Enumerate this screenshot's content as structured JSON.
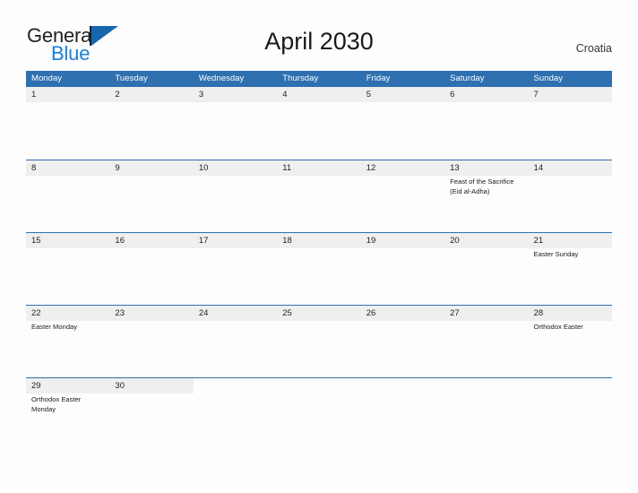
{
  "brand": {
    "name_part1": "General",
    "name_part2": "Blue",
    "logo_icon": "triangle-logo-icon"
  },
  "header": {
    "title": "April 2030",
    "country": "Croatia"
  },
  "calendar": {
    "weekdays": [
      "Monday",
      "Tuesday",
      "Wednesday",
      "Thursday",
      "Friday",
      "Saturday",
      "Sunday"
    ],
    "accent_color": "#2e70b0",
    "band_color": "#efefef",
    "weeks": [
      [
        {
          "day": "1",
          "events": []
        },
        {
          "day": "2",
          "events": []
        },
        {
          "day": "3",
          "events": []
        },
        {
          "day": "4",
          "events": []
        },
        {
          "day": "5",
          "events": []
        },
        {
          "day": "6",
          "events": []
        },
        {
          "day": "7",
          "events": []
        }
      ],
      [
        {
          "day": "8",
          "events": []
        },
        {
          "day": "9",
          "events": []
        },
        {
          "day": "10",
          "events": []
        },
        {
          "day": "11",
          "events": []
        },
        {
          "day": "12",
          "events": []
        },
        {
          "day": "13",
          "events": [
            "Feast of the Sacrifice (Eid al-Adha)"
          ]
        },
        {
          "day": "14",
          "events": []
        }
      ],
      [
        {
          "day": "15",
          "events": []
        },
        {
          "day": "16",
          "events": []
        },
        {
          "day": "17",
          "events": []
        },
        {
          "day": "18",
          "events": []
        },
        {
          "day": "19",
          "events": []
        },
        {
          "day": "20",
          "events": []
        },
        {
          "day": "21",
          "events": [
            "Easter Sunday"
          ]
        }
      ],
      [
        {
          "day": "22",
          "events": [
            "Easter Monday"
          ]
        },
        {
          "day": "23",
          "events": []
        },
        {
          "day": "24",
          "events": []
        },
        {
          "day": "25",
          "events": []
        },
        {
          "day": "26",
          "events": []
        },
        {
          "day": "27",
          "events": []
        },
        {
          "day": "28",
          "events": [
            "Orthodox Easter"
          ]
        }
      ],
      [
        {
          "day": "29",
          "events": [
            "Orthodox Easter Monday"
          ]
        },
        {
          "day": "30",
          "events": []
        },
        {
          "day": "",
          "events": []
        },
        {
          "day": "",
          "events": []
        },
        {
          "day": "",
          "events": []
        },
        {
          "day": "",
          "events": []
        },
        {
          "day": "",
          "events": []
        }
      ]
    ]
  }
}
